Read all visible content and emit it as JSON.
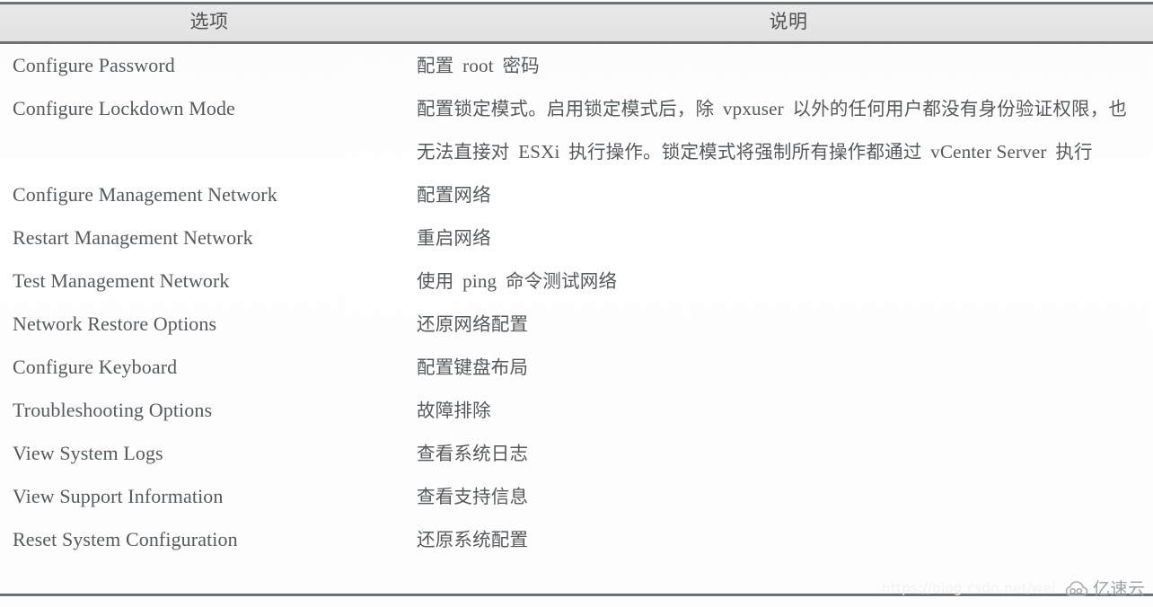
{
  "table": {
    "headers": {
      "option": "选项",
      "description": "说明"
    },
    "rows": [
      {
        "option": "Configure Password",
        "description": "配置 root 密码"
      },
      {
        "option": "Configure Lockdown Mode",
        "description": "配置锁定模式。启用锁定模式后，除 vpxuser 以外的任何用户都没有身份验证权限，也无法直接对 ESXi 执行操作。锁定模式将强制所有操作都通过 vCenter Server 执行"
      },
      {
        "option": "Configure Management Network",
        "description": "配置网络"
      },
      {
        "option": "Restart Management Network",
        "description": "重启网络"
      },
      {
        "option": "Test Management Network",
        "description": "使用 ping 命令测试网络"
      },
      {
        "option": "Network Restore Options",
        "description": "还原网络配置"
      },
      {
        "option": "Configure Keyboard",
        "description": "配置键盘布局"
      },
      {
        "option": "Troubleshooting Options",
        "description": "故障排除"
      },
      {
        "option": "View System Logs",
        "description": "查看系统日志"
      },
      {
        "option": "View Support Information",
        "description": "查看支持信息"
      },
      {
        "option": "Reset System Configuration",
        "description": "还原系统配置"
      }
    ]
  },
  "watermarks": {
    "url": "https://blog.csdn.net/wei",
    "brand": "亿速云",
    "logo_icon": "cloud-icon"
  },
  "colors": {
    "rule": "#6f7274",
    "header_background": "#e6e6e6",
    "header_text": "#4f5254",
    "body_text": "#56595c",
    "watermark_url": "#f2f2f2",
    "watermark_brand": "#9da2a7"
  }
}
